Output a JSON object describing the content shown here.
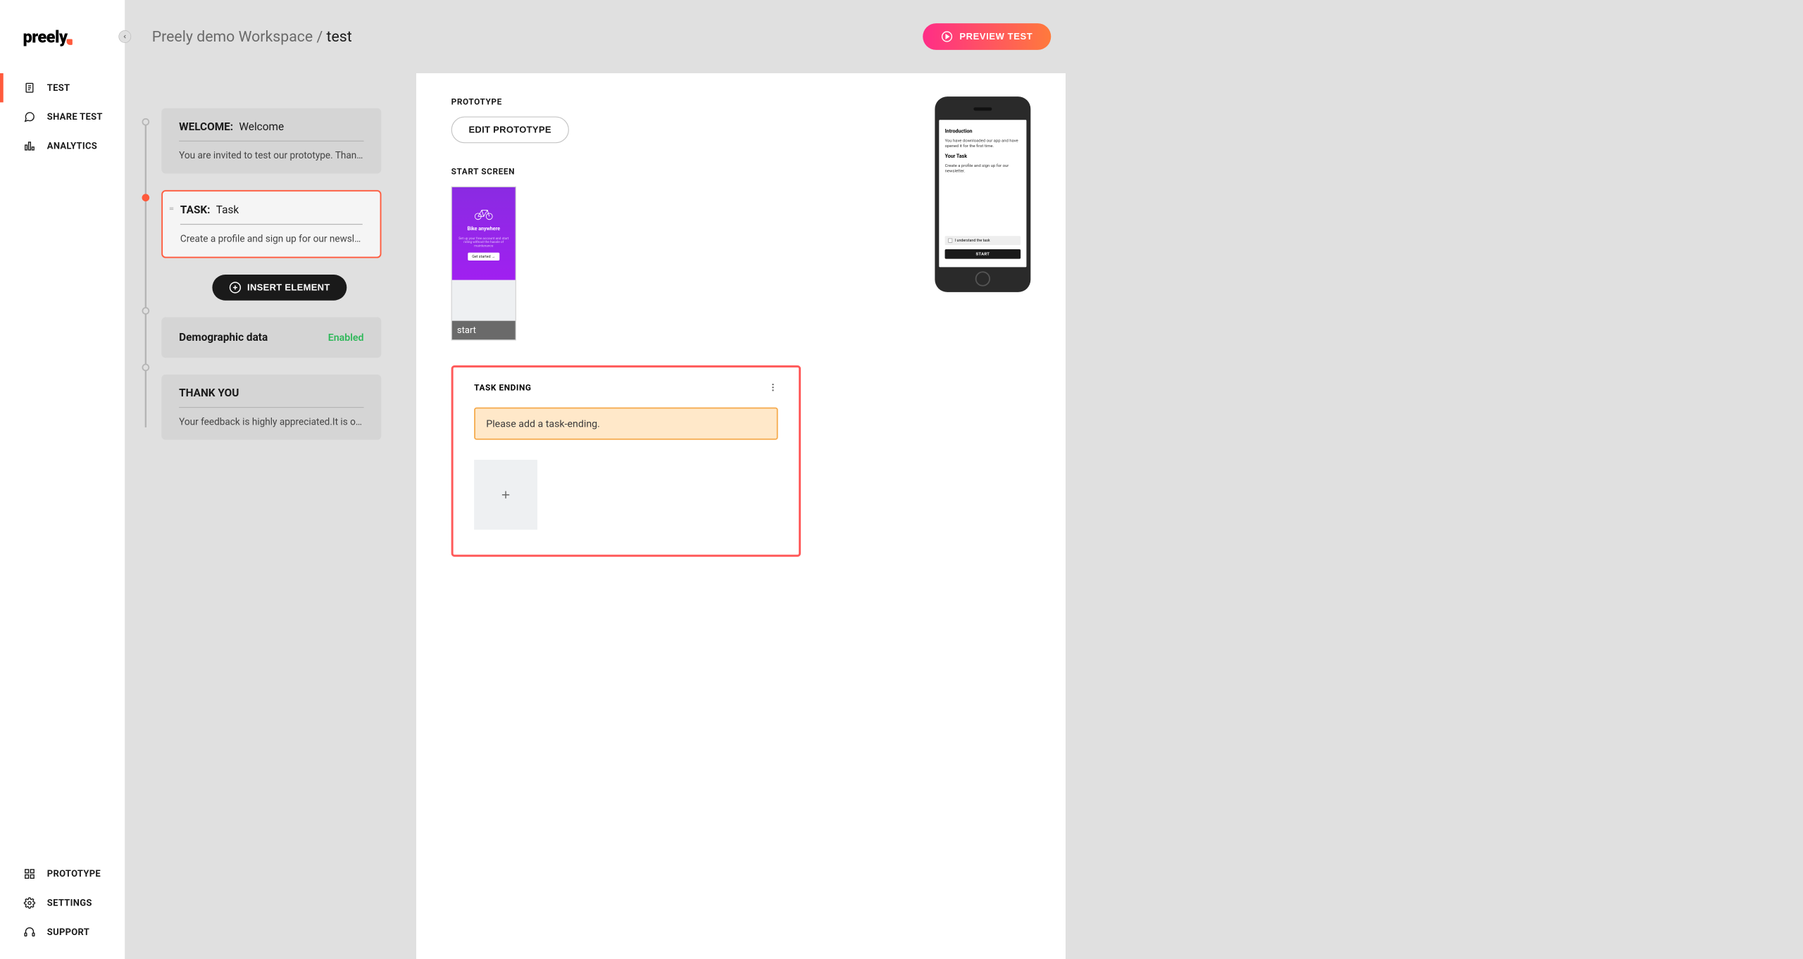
{
  "brand": "preely",
  "breadcrumb": {
    "workspace": "Preely demo Workspace",
    "sep": "/",
    "current": "test"
  },
  "nav": {
    "test": "TEST",
    "share": "SHARE TEST",
    "analytics": "ANALYTICS",
    "prototype": "PROTOTYPE",
    "settings": "SETTINGS",
    "support": "SUPPORT"
  },
  "preview_btn": "PREVIEW TEST",
  "cards": {
    "welcome": {
      "label": "WELCOME:",
      "title": "Welcome",
      "body": "You are invited to test our prototype. Thank yo…"
    },
    "task": {
      "label": "TASK:",
      "title": "Task",
      "body": "Create a profile and sign up for our newsletter."
    },
    "demographic": {
      "title": "Demographic data",
      "status": "Enabled"
    },
    "thankyou": {
      "label": "THANK YOU",
      "body": "Your feedback is highly appreciated.It is of gr…"
    }
  },
  "insert_btn": "INSERT ELEMENT",
  "right": {
    "prototype_label": "PROTOTYPE",
    "edit_btn": "EDIT PROTOTYPE",
    "start_label": "START SCREEN",
    "start_thumb": {
      "title": "Bike anywhere",
      "subtitle": "Set up your free account and start riding without the hassle of maintenance",
      "cta": "Get started →",
      "caption": "start"
    },
    "task_ending": {
      "label": "TASK ENDING",
      "warning": "Please add a task-ending."
    }
  },
  "phone": {
    "intro_title": "Introduction",
    "intro_text": "You have downloaded our app and have opened it for the first time.",
    "task_title": "Your Task",
    "task_text": "Create a profile and sign up for our newsletter.",
    "check": "I understand the task",
    "start": "START"
  }
}
